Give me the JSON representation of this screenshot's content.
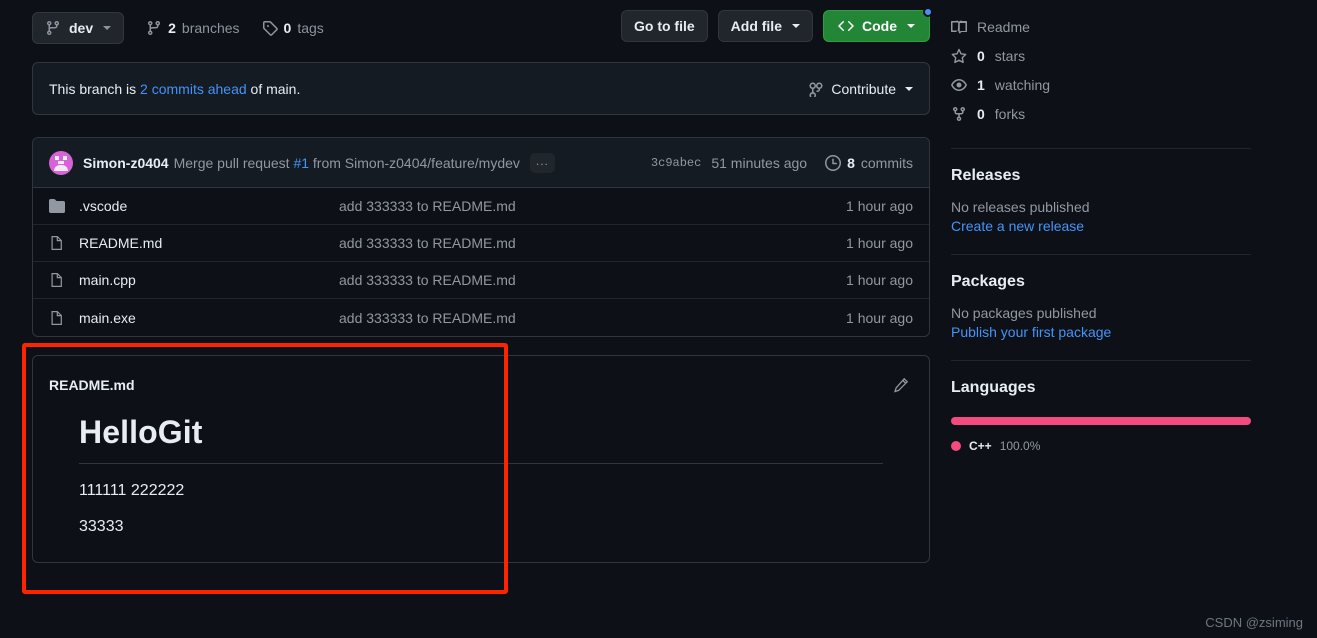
{
  "toolbar": {
    "branch_button": {
      "label": "dev",
      "icon": "branch-icon"
    },
    "branches": {
      "count": "2",
      "label": "branches"
    },
    "tags": {
      "count": "0",
      "label": "tags"
    },
    "go_to_file": "Go to file",
    "add_file": "Add file",
    "code": "Code"
  },
  "notice": {
    "prefix": "This branch is",
    "link": "2 commits ahead",
    "suffix": "of main.",
    "contribute": "Contribute"
  },
  "commit_header": {
    "author": "Simon-z0404",
    "message_prefix": "Merge pull request",
    "pr_number": "#1",
    "message_suffix": "from Simon-z0404/feature/mydev",
    "expand": "...",
    "sha": "3c9abec",
    "time": "51 minutes ago",
    "commits_count": "8",
    "commits_label": "commits"
  },
  "files": [
    {
      "icon": "folder-icon",
      "name": ".vscode",
      "message": "add 333333 to README.md",
      "age": "1 hour ago"
    },
    {
      "icon": "file-icon",
      "name": "README.md",
      "message": "add 333333 to README.md",
      "age": "1 hour ago"
    },
    {
      "icon": "file-icon",
      "name": "main.cpp",
      "message": "add 333333 to README.md",
      "age": "1 hour ago"
    },
    {
      "icon": "file-icon",
      "name": "main.exe",
      "message": "add 333333 to README.md",
      "age": "1 hour ago"
    }
  ],
  "readme": {
    "title": "README.md",
    "edit_icon": "pencil-icon",
    "heading": "HelloGit",
    "paragraph1": "111111 222222",
    "paragraph2": "33333"
  },
  "sidebar": {
    "rows": [
      {
        "icon": "book-icon",
        "text": "Readme",
        "count": "",
        "rest": ""
      },
      {
        "icon": "star-icon",
        "text": "stars",
        "count": "0",
        "rest": "stars"
      },
      {
        "icon": "eye-icon",
        "text": "watching",
        "count": "1",
        "rest": "watching"
      },
      {
        "icon": "fork-icon",
        "text": "forks",
        "count": "0",
        "rest": "forks"
      }
    ],
    "readme_label": "Readme",
    "stars_count": "0",
    "stars_label": "stars",
    "watching_count": "1",
    "watching_label": "watching",
    "forks_count": "0",
    "forks_label": "forks",
    "releases": {
      "title": "Releases",
      "empty": "No releases published",
      "link": "Create a new release"
    },
    "packages": {
      "title": "Packages",
      "empty": "No packages published",
      "link": "Publish your first package"
    },
    "languages": {
      "title": "Languages",
      "items": [
        {
          "name": "C++",
          "percent": "100.0%",
          "color": "#f34b7d",
          "width": "100%"
        }
      ]
    }
  },
  "colors": {
    "accent_link": "#4493f8",
    "code_green": "#238636",
    "notif_dot": "#4493f8",
    "annotation_red": "#ff2400",
    "cpp_pink": "#f34b7d",
    "background": "#0d1117"
  },
  "watermark": "CSDN @zsiming"
}
